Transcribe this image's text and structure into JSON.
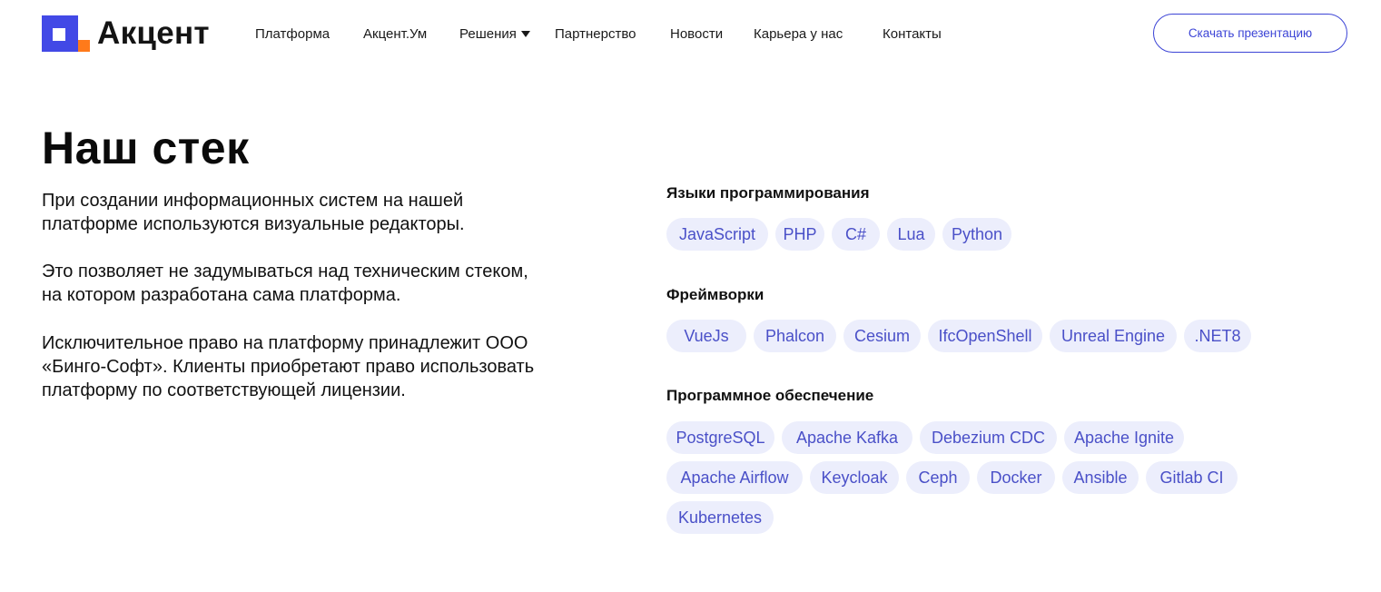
{
  "header": {
    "logo_text": "Акцент",
    "logo_colors": {
      "primary": "#4249e6",
      "accent": "#ff7a1a"
    },
    "nav": [
      {
        "label": "Платформа"
      },
      {
        "label": "Акцент.Ум"
      },
      {
        "label": "Решения",
        "icon": "caret-down-icon"
      },
      {
        "label": "Партнерство"
      },
      {
        "label": "Новости"
      },
      {
        "label": "Карьера у нас"
      },
      {
        "label": "Контакты"
      }
    ],
    "cta_label": "Скачать презентацию"
  },
  "main": {
    "title": "Наш стек",
    "paragraphs": [
      "При создании информационных систем на нашей платформе используются визуальные редакторы.",
      "Это позволяет не задумываться над техническим стеком, на котором разработана сама платформа.",
      "Исключительное право на платформу принадлежит ООО «Бинго-Софт». Клиенты приобретают право использовать платформу по соответствующей лицензии."
    ]
  },
  "stack": {
    "groups": [
      {
        "title": "Языки программирования",
        "tags": [
          "JavaScript",
          "PHP",
          "C#",
          "Lua",
          "Python"
        ]
      },
      {
        "title": "Фреймворки",
        "tags": [
          "VueJs",
          "Phalcon",
          "Cesium",
          "IfcOpenShell",
          "Unreal Engine",
          ".NET8"
        ]
      },
      {
        "title": "Программное обеспечение",
        "tags": [
          "PostgreSQL",
          "Apache Kafka",
          "Debezium CDC",
          "Apache Ignite",
          "Apache Airflow",
          "Keycloak",
          "Ceph",
          "Docker",
          "Ansible",
          "Gitlab CI",
          "Kubernetes"
        ]
      }
    ]
  },
  "colors": {
    "accent": "#3c44d6",
    "tag_bg": "#eceefc",
    "tag_text": "#4a50c8"
  }
}
